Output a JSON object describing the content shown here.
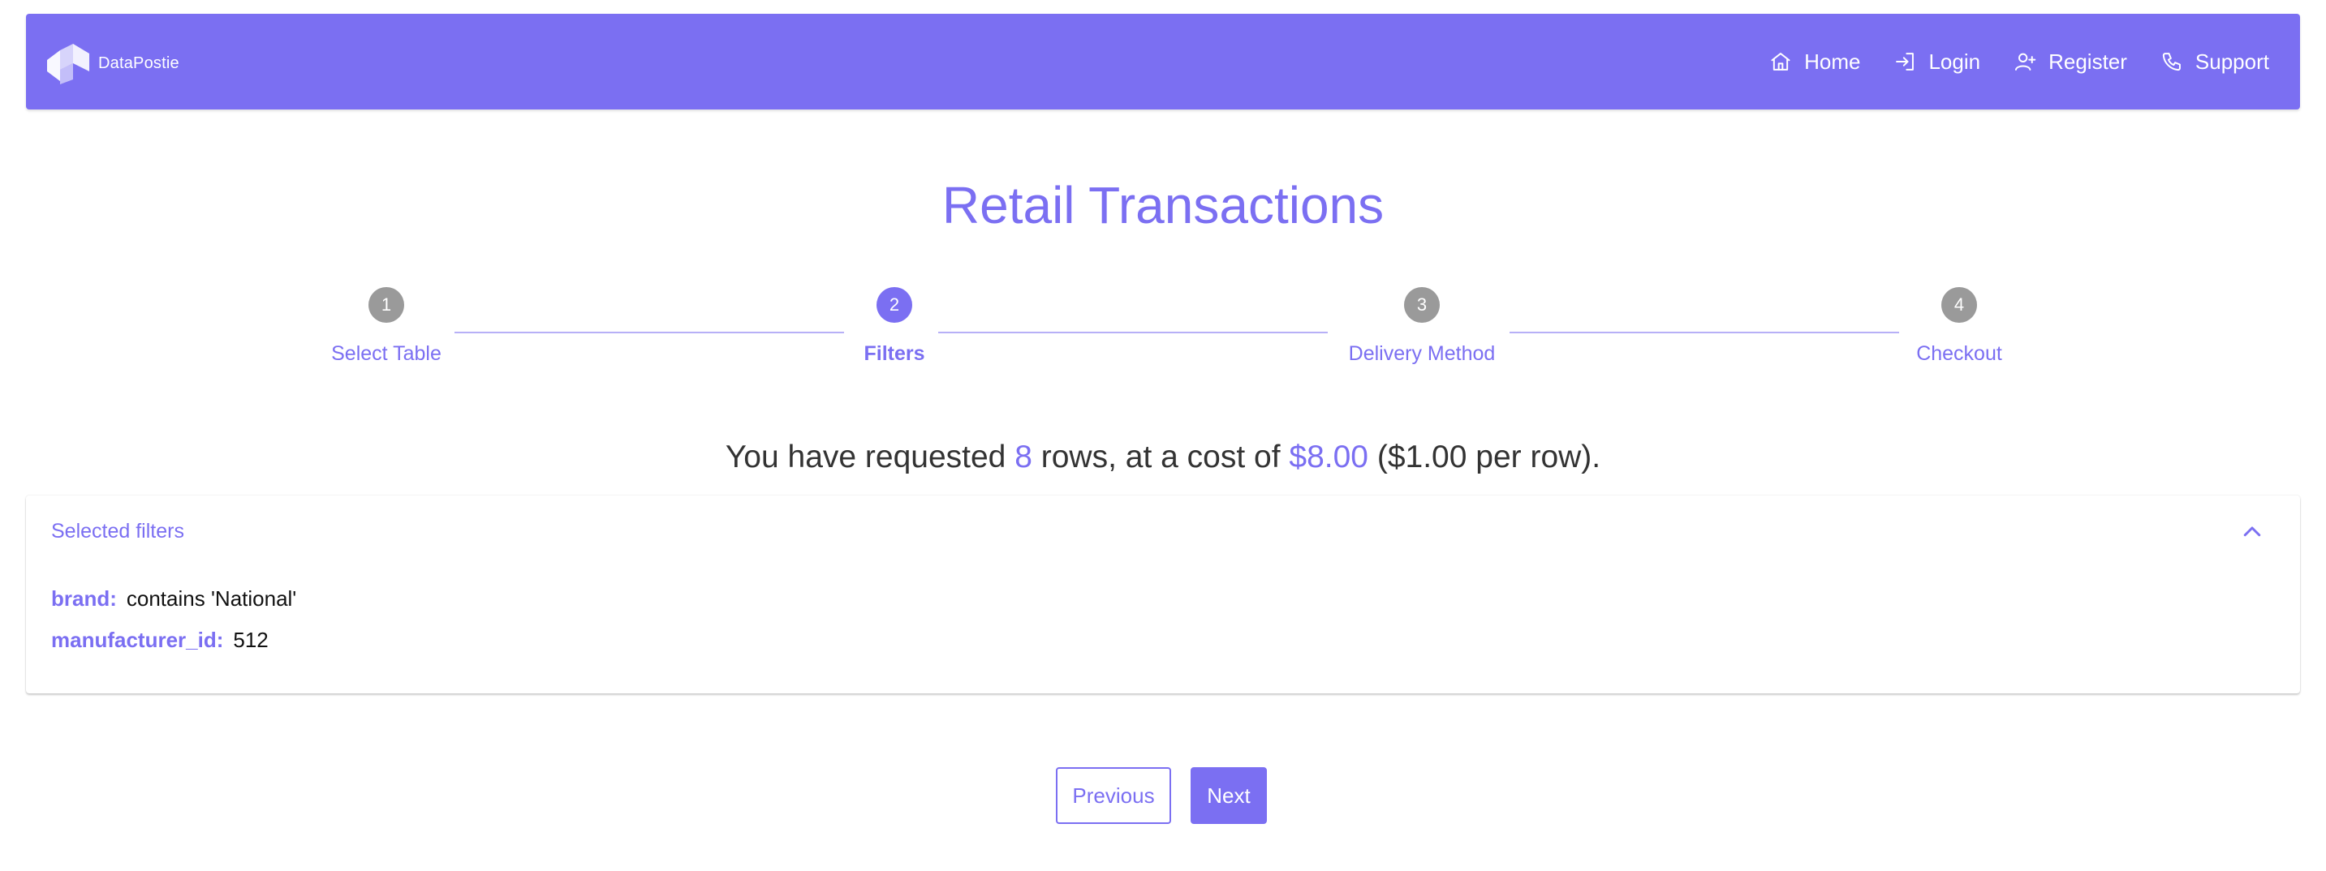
{
  "brand": {
    "name": "DataPostie",
    "logo_icon": "datapostie-logo-icon"
  },
  "nav": {
    "items": [
      {
        "label": "Home",
        "icon": "home-icon"
      },
      {
        "label": "Login",
        "icon": "login-icon"
      },
      {
        "label": "Register",
        "icon": "user-plus-icon"
      },
      {
        "label": "Support",
        "icon": "phone-icon"
      }
    ]
  },
  "page": {
    "title": "Retail Transactions"
  },
  "stepper": {
    "steps": [
      {
        "number": "1",
        "label": "Select Table",
        "state": "complete"
      },
      {
        "number": "2",
        "label": "Filters",
        "state": "active"
      },
      {
        "number": "3",
        "label": "Delivery Method",
        "state": "pending"
      },
      {
        "number": "4",
        "label": "Checkout",
        "state": "pending"
      }
    ]
  },
  "summary": {
    "prefix": "You have requested ",
    "rows": "8",
    "middle": " rows, at a cost of ",
    "cost": "$8.00",
    "suffix": " ($1.00 per row)."
  },
  "filters_panel": {
    "title": "Selected filters",
    "expanded": true,
    "toggle_icon": "chevron-up-icon",
    "filters": [
      {
        "key": "brand:",
        "value": "contains 'National'"
      },
      {
        "key": "manufacturer_id:",
        "value": "512"
      }
    ]
  },
  "actions": {
    "previous_label": "Previous",
    "next_label": "Next"
  },
  "colors": {
    "accent": "#7b6ff2",
    "step_inactive": "#9a9a9a",
    "connector": "#b7b0f7",
    "text": "#333333"
  }
}
